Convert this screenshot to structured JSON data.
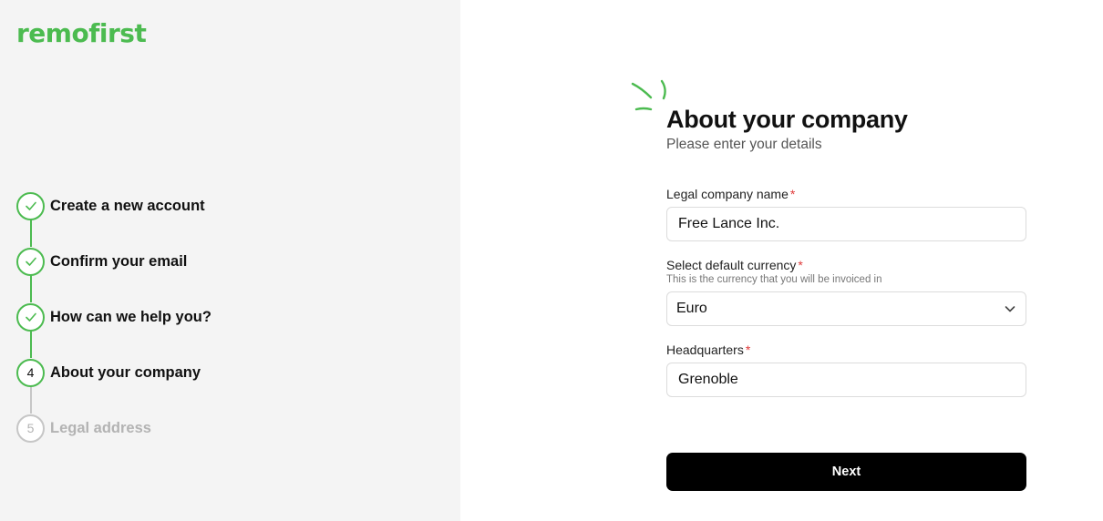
{
  "brand": {
    "logo_text": "remofirst",
    "accent_color": "#4cbb50"
  },
  "steps": [
    {
      "number": "1",
      "label": "Create a new account",
      "status": "completed",
      "icon": "check-icon"
    },
    {
      "number": "2",
      "label": "Confirm your email",
      "status": "completed",
      "icon": "check-icon"
    },
    {
      "number": "3",
      "label": "How can we help you?",
      "status": "completed",
      "icon": "check-icon"
    },
    {
      "number": "4",
      "label": "About your company",
      "status": "current"
    },
    {
      "number": "5",
      "label": "Legal address",
      "status": "pending"
    }
  ],
  "form": {
    "title": "About your company",
    "subtitle": "Please enter your details",
    "required_marker": "*",
    "company_name": {
      "label": "Legal company name",
      "value": "Free Lance Inc."
    },
    "currency": {
      "label": "Select default currency",
      "hint": "This is the currency that you will be invoiced in",
      "value": "Euro",
      "icon": "chevron-down-icon"
    },
    "headquarters": {
      "label": "Headquarters",
      "value": "Grenoble"
    },
    "next_label": "Next"
  },
  "colors": {
    "required": "#e03a3a",
    "completed": "#4cbb50",
    "pending": "#c6c6c6",
    "button": "#000000"
  }
}
